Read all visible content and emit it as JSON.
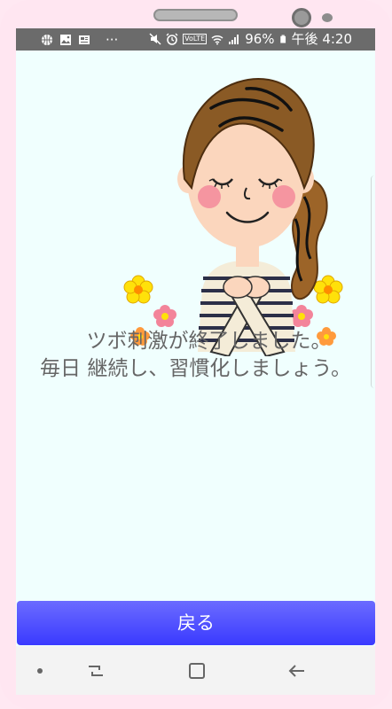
{
  "status_bar": {
    "left_icons": [
      "basketball-icon",
      "image-icon",
      "news-icon",
      "more-dots-icon"
    ],
    "more": "···",
    "right_icons": [
      "mute-icon",
      "alarm-icon",
      "volte-icon",
      "wifi-icon",
      "signal-icon",
      "battery-icon"
    ],
    "volte_text": "VoLTE",
    "battery": "96%",
    "time": "午後 4:20"
  },
  "illustration": {
    "subject": "woman-with-crossed-hands",
    "colors": {
      "hair": "#8a5a25",
      "skin": "#fbd6bd",
      "cheek": "#f38a9b",
      "flower_yellow": "#ffe10a",
      "flower_pink": "#f3849a",
      "flower_orange": "#ff9a3c"
    }
  },
  "message": {
    "line1": "ツボ刺激が終了しました。",
    "line2": "毎日 継続し、習慣化しましょう。"
  },
  "back_button": {
    "label": "戻る"
  },
  "nav_bar": {
    "items": [
      "dot-icon",
      "recents-icon",
      "home-icon",
      "back-arrow-icon"
    ]
  },
  "colors": {
    "screen_bg": "#f0fffe",
    "button_top": "#6b6bff",
    "button_bottom": "#3a3aff",
    "frame": "#ffe6f1"
  }
}
